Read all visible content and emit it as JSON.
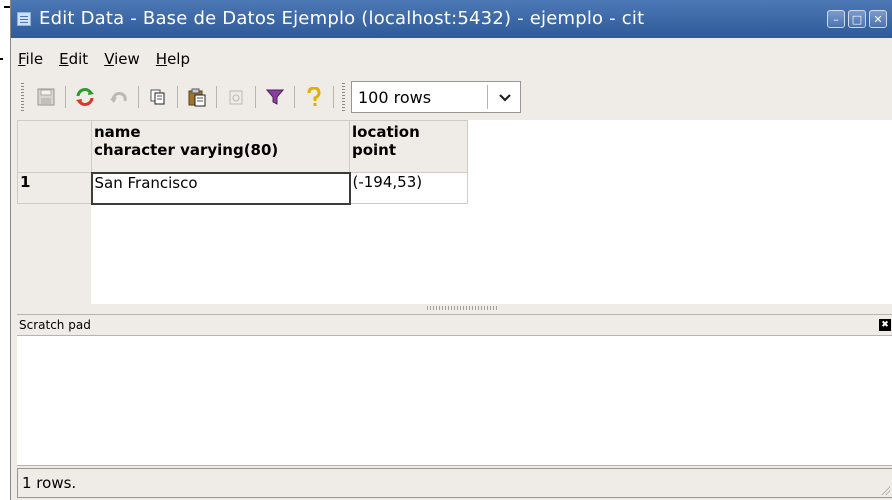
{
  "window": {
    "title": "Edit Data - Base de Datos Ejemplo (localhost:5432) - ejemplo - cit"
  },
  "menubar": {
    "items": [
      {
        "label_pre": "",
        "mnemonic": "F",
        "label_post": "ile"
      },
      {
        "label_pre": "",
        "mnemonic": "E",
        "label_post": "dit"
      },
      {
        "label_pre": "",
        "mnemonic": "V",
        "label_post": "iew"
      },
      {
        "label_pre": "",
        "mnemonic": "H",
        "label_post": "elp"
      }
    ]
  },
  "toolbar": {
    "icons": [
      "save-icon",
      "refresh-icon",
      "undo-icon",
      "copy-icon",
      "paste-icon",
      "delete-icon",
      "filter-icon",
      "help-icon"
    ],
    "rows_limit": "100 rows"
  },
  "grid": {
    "columns": [
      {
        "name": "name",
        "type": "character varying(80)"
      },
      {
        "name": "location",
        "type": "point"
      }
    ],
    "rows": [
      {
        "num": "1",
        "cells": [
          "San Francisco",
          "(-194,53)"
        ]
      }
    ]
  },
  "scratch_pad": {
    "title": "Scratch pad"
  },
  "status": {
    "text": "1 rows."
  },
  "colors": {
    "titlebar": "#3b64a4",
    "window_bg": "#efebe7",
    "grid_bg": "#ffffff"
  }
}
